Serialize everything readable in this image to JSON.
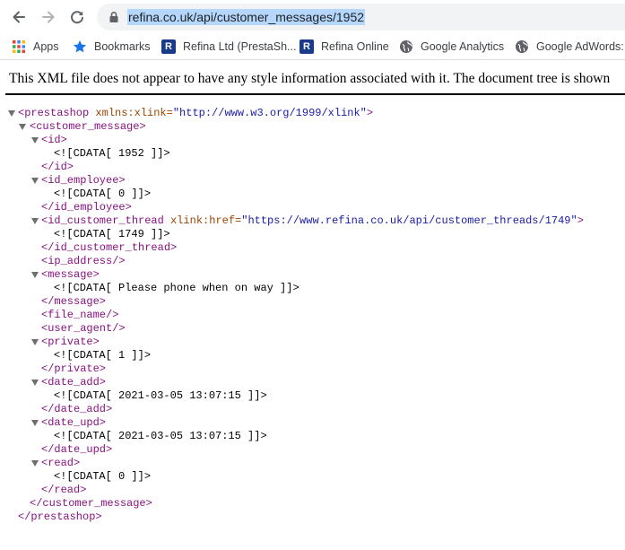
{
  "browser": {
    "url": "refina.co.uk/api/customer_messages/1952"
  },
  "bookmarks": [
    {
      "label": "Apps",
      "icon": "apps-grid-icon"
    },
    {
      "label": "Bookmarks",
      "icon": "star-icon"
    },
    {
      "label": "Refina Ltd (PrestaSh...",
      "icon": "refina-r-icon"
    },
    {
      "label": "Refina Online",
      "icon": "refina-r-icon"
    },
    {
      "label": "Google Analytics",
      "icon": "globe-icon"
    },
    {
      "label": "Google AdWords: I",
      "icon": "globe-icon"
    }
  ],
  "notice": "This XML file does not appear to have any style information associated with it. The document tree is shown",
  "xml": {
    "root_open_tag": "<prestashop",
    "root_attr_name": " xmlns:xlink=",
    "root_attr_value": "\"http://www.w3.org/1999/xlink\"",
    "root_open_close": ">",
    "root_close": "</prestashop>",
    "cm_open": "<customer_message>",
    "cm_close": "</customer_message>",
    "id_open": "<id>",
    "id_value": "<![CDATA[ 1952 ]]>",
    "id_close": "</id>",
    "emp_open": "<id_employee>",
    "emp_value": "<![CDATA[ 0 ]]>",
    "emp_close": "</id_employee>",
    "thread_open_tag": "<id_customer_thread",
    "thread_attr_name": " xlink:href=",
    "thread_attr_value": "\"https://www.refina.co.uk/api/customer_threads/1749\"",
    "thread_open_close": ">",
    "thread_value": "<![CDATA[ 1749 ]]>",
    "thread_close": "</id_customer_thread>",
    "ip_empty": "<ip_address/>",
    "msg_open": "<message>",
    "msg_value": "<![CDATA[ Please phone when on way ]]>",
    "msg_close": "</message>",
    "file_empty": "<file_name/>",
    "ua_empty": "<user_agent/>",
    "priv_open": "<private>",
    "priv_value": "<![CDATA[ 1 ]]>",
    "priv_close": "</private>",
    "dadd_open": "<date_add>",
    "dadd_value": "<![CDATA[ 2021-03-05 13:07:15 ]]>",
    "dadd_close": "</date_add>",
    "dupd_open": "<date_upd>",
    "dupd_value": "<![CDATA[ 2021-03-05 13:07:15 ]]>",
    "dupd_close": "</date_upd>",
    "read_open": "<read>",
    "read_value": "<![CDATA[ 0 ]]>",
    "read_close": "</read>"
  }
}
